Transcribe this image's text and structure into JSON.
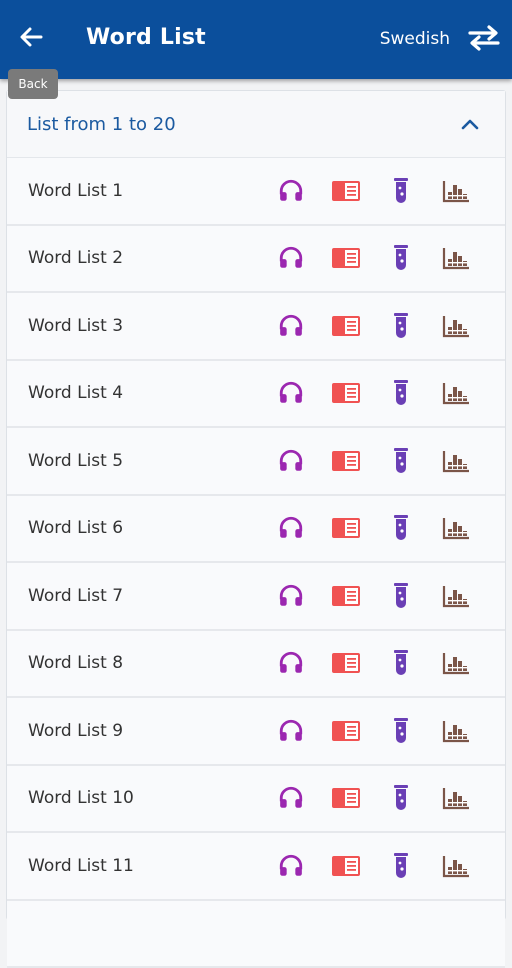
{
  "header": {
    "title": "Word List",
    "language": "Swedish",
    "back_tooltip": "Back",
    "background": "#0b4f9c"
  },
  "section": {
    "title": "List from 1 to 20",
    "expanded": true
  },
  "icons": {
    "listen": {
      "name": "headphones-icon",
      "color": "#9b27b0"
    },
    "study": {
      "name": "book-icon",
      "color": "#f05252"
    },
    "test": {
      "name": "test-tube-icon",
      "color": "#6a3fb5"
    },
    "stats": {
      "name": "bar-chart-icon",
      "color": "#7b5548"
    }
  },
  "word_lists": [
    {
      "label": "Word List 1"
    },
    {
      "label": "Word List 2"
    },
    {
      "label": "Word List 3"
    },
    {
      "label": "Word List 4"
    },
    {
      "label": "Word List 5"
    },
    {
      "label": "Word List 6"
    },
    {
      "label": "Word List 7"
    },
    {
      "label": "Word List 8"
    },
    {
      "label": "Word List 9"
    },
    {
      "label": "Word List 10"
    },
    {
      "label": "Word List 11"
    },
    {
      "label": ""
    }
  ]
}
